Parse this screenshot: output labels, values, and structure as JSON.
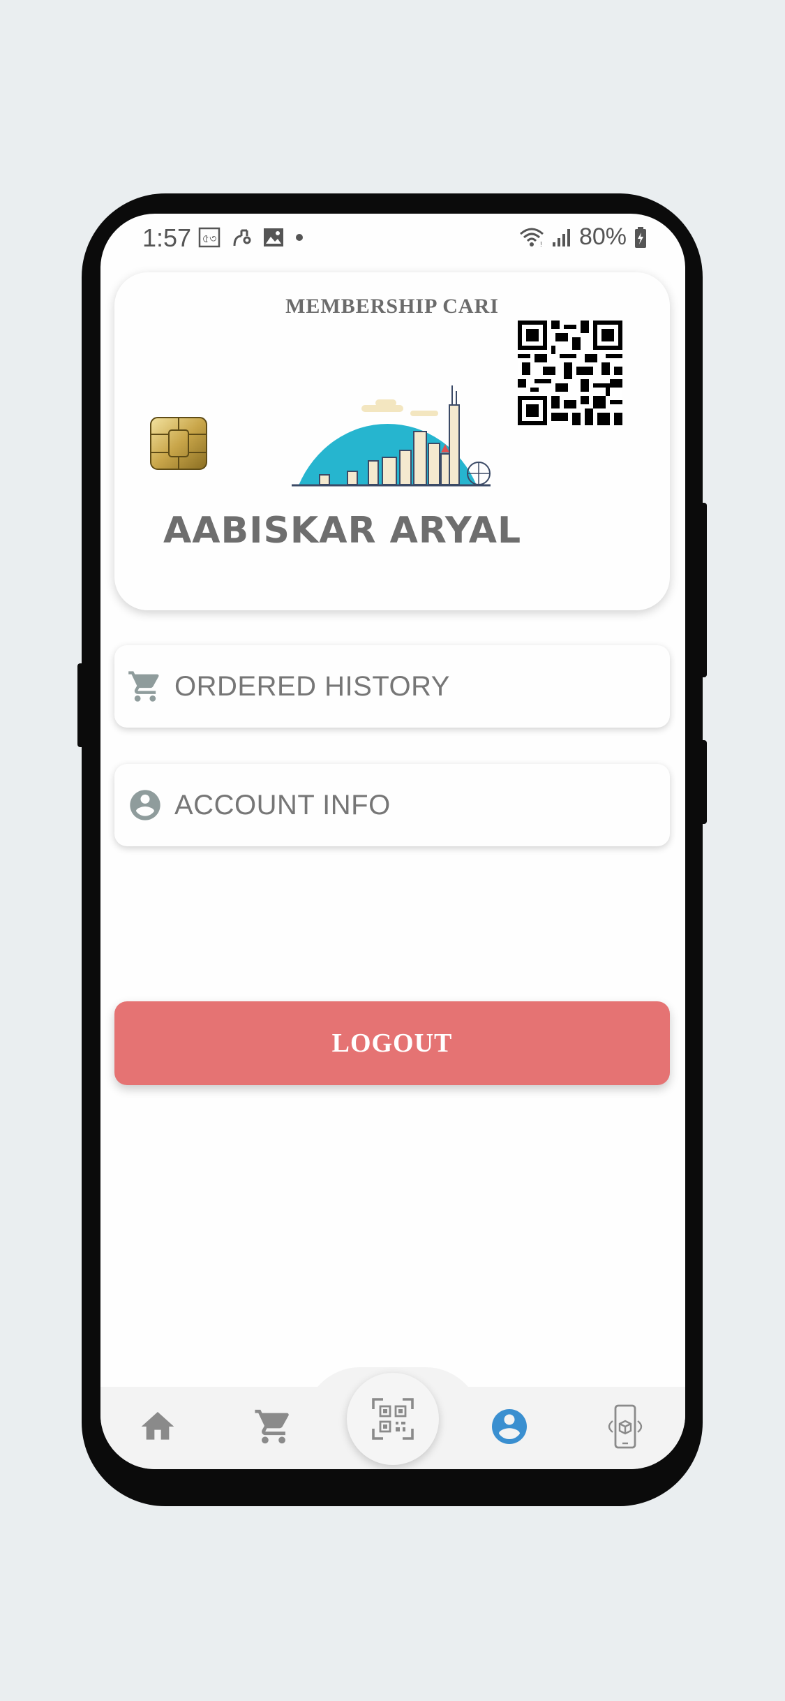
{
  "status_bar": {
    "time": "1:57",
    "battery": "80%",
    "icons_left": [
      "notification-app-icon",
      "link-icon",
      "image-icon",
      "dot-icon"
    ],
    "icons_right": [
      "wifi-icon",
      "signal-icon",
      "battery-icon"
    ]
  },
  "membership_card": {
    "title": "MEMBERSHIP CARI",
    "holder_name": "AABISKAR ARYAL",
    "icons": [
      "chip-icon",
      "city-skyline-illustration",
      "qr-code"
    ]
  },
  "menu": {
    "ordered_history": "ORDERED HISTORY",
    "account_info": "ACCOUNT INFO"
  },
  "logout_label": "LOGOUT",
  "colors": {
    "logout": "#e57373",
    "active_nav": "#3a8fd0",
    "inactive_nav": "#8a8a8a",
    "skyline_sky": "#26b5cf"
  },
  "bottom_nav": {
    "items": [
      "home-icon",
      "cart-icon",
      "qr-scan-icon",
      "profile-icon",
      "ar-phone-icon"
    ],
    "active": "profile-icon"
  }
}
